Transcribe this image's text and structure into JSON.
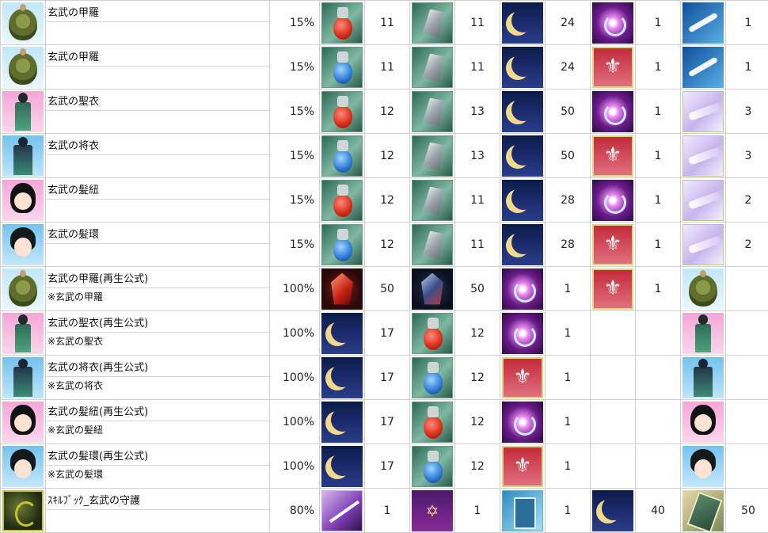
{
  "rows": [
    {
      "name": "玄武の甲羅",
      "sub": "",
      "item_icon": "turtle-shell-icon",
      "rate": "15%",
      "materials": [
        {
          "icon": "red-bag-icon",
          "qty": "11"
        },
        {
          "icon": "metal-shard-icon",
          "qty": "11"
        },
        {
          "icon": "crescent-moon-icon",
          "qty": "24"
        },
        {
          "icon": "magic-orb-icon",
          "qty": "1"
        },
        {
          "icon": "feather-icon",
          "qty": "1"
        }
      ],
      "result_icon": ""
    },
    {
      "name": "玄武の甲羅",
      "sub": "",
      "item_icon": "turtle-shell-icon",
      "rate": "15%",
      "materials": [
        {
          "icon": "blue-bag-icon",
          "qty": "11"
        },
        {
          "icon": "metal-shard-icon",
          "qty": "11"
        },
        {
          "icon": "crescent-moon-icon",
          "qty": "24"
        },
        {
          "icon": "fleur-de-lis-icon",
          "qty": "1"
        },
        {
          "icon": "feather-icon",
          "qty": "1"
        }
      ],
      "result_icon": ""
    },
    {
      "name": "玄武の聖衣",
      "sub": "",
      "item_icon": "sacred-robe-icon",
      "rate": "15%",
      "materials": [
        {
          "icon": "red-bag-icon",
          "qty": "12"
        },
        {
          "icon": "metal-shard-icon",
          "qty": "13"
        },
        {
          "icon": "crescent-moon-icon",
          "qty": "50"
        },
        {
          "icon": "magic-orb-icon",
          "qty": "1"
        },
        {
          "icon": "angel-wing-icon",
          "qty": "3"
        }
      ],
      "result_icon": ""
    },
    {
      "name": "玄武の将衣",
      "sub": "",
      "item_icon": "general-coat-icon",
      "rate": "15%",
      "materials": [
        {
          "icon": "blue-bag-icon",
          "qty": "12"
        },
        {
          "icon": "metal-shard-icon",
          "qty": "13"
        },
        {
          "icon": "crescent-moon-icon",
          "qty": "50"
        },
        {
          "icon": "fleur-de-lis-icon",
          "qty": "1"
        },
        {
          "icon": "angel-wing-icon",
          "qty": "3"
        }
      ],
      "result_icon": ""
    },
    {
      "name": "玄武の髪紐",
      "sub": "",
      "item_icon": "hair-string-icon",
      "rate": "15%",
      "materials": [
        {
          "icon": "red-bag-icon",
          "qty": "12"
        },
        {
          "icon": "metal-shard-icon",
          "qty": "11"
        },
        {
          "icon": "crescent-moon-icon",
          "qty": "28"
        },
        {
          "icon": "magic-orb-icon",
          "qty": "1"
        },
        {
          "icon": "angel-wing-icon",
          "qty": "2"
        }
      ],
      "result_icon": ""
    },
    {
      "name": "玄武の髪環",
      "sub": "",
      "item_icon": "hair-ring-icon",
      "rate": "15%",
      "materials": [
        {
          "icon": "blue-bag-icon",
          "qty": "12"
        },
        {
          "icon": "metal-shard-icon",
          "qty": "11"
        },
        {
          "icon": "crescent-moon-icon",
          "qty": "28"
        },
        {
          "icon": "fleur-de-lis-icon",
          "qty": "1"
        },
        {
          "icon": "angel-wing-icon",
          "qty": "2"
        }
      ],
      "result_icon": ""
    },
    {
      "name": "玄武の甲羅(再生公式)",
      "sub": "※玄武の甲羅",
      "item_icon": "turtle-shell-icon",
      "rate": "100%",
      "materials": [
        {
          "icon": "red-gem-icon",
          "qty": "50"
        },
        {
          "icon": "blue-gem-icon",
          "qty": "50"
        },
        {
          "icon": "magic-orb-icon",
          "qty": "1"
        },
        {
          "icon": "fleur-de-lis-icon",
          "qty": "1"
        },
        {
          "icon": "",
          "qty": ""
        }
      ],
      "result_icon": "turtle-shell-icon"
    },
    {
      "name": "玄武の聖衣(再生公式)",
      "sub": "※玄武の聖衣",
      "item_icon": "sacred-robe-icon",
      "rate": "100%",
      "materials": [
        {
          "icon": "crescent-moon-icon",
          "qty": "17"
        },
        {
          "icon": "red-bag-icon",
          "qty": "12"
        },
        {
          "icon": "magic-orb-icon",
          "qty": "1"
        },
        {
          "icon": "",
          "qty": ""
        },
        {
          "icon": "",
          "qty": ""
        }
      ],
      "result_icon": "sacred-robe-icon"
    },
    {
      "name": "玄武の将衣(再生公式)",
      "sub": "※玄武の将衣",
      "item_icon": "general-coat-icon",
      "rate": "100%",
      "materials": [
        {
          "icon": "crescent-moon-icon",
          "qty": "17"
        },
        {
          "icon": "blue-bag-icon",
          "qty": "12"
        },
        {
          "icon": "fleur-de-lis-icon",
          "qty": "1"
        },
        {
          "icon": "",
          "qty": ""
        },
        {
          "icon": "",
          "qty": ""
        }
      ],
      "result_icon": "general-coat-icon"
    },
    {
      "name": "玄武の髪紐(再生公式)",
      "sub": "※玄武の髪紐",
      "item_icon": "hair-string-icon",
      "rate": "100%",
      "materials": [
        {
          "icon": "crescent-moon-icon",
          "qty": "17"
        },
        {
          "icon": "red-bag-icon",
          "qty": "12"
        },
        {
          "icon": "magic-orb-icon",
          "qty": "1"
        },
        {
          "icon": "",
          "qty": ""
        },
        {
          "icon": "",
          "qty": ""
        }
      ],
      "result_icon": "hair-string-icon"
    },
    {
      "name": "玄武の髪環(再生公式)",
      "sub": "※玄武の髪環",
      "item_icon": "hair-ring-icon",
      "rate": "100%",
      "materials": [
        {
          "icon": "crescent-moon-icon",
          "qty": "17"
        },
        {
          "icon": "blue-bag-icon",
          "qty": "12"
        },
        {
          "icon": "fleur-de-lis-icon",
          "qty": "1"
        },
        {
          "icon": "",
          "qty": ""
        },
        {
          "icon": "",
          "qty": ""
        }
      ],
      "result_icon": "hair-ring-icon"
    },
    {
      "name": "ｽｷﾙﾌﾞｯｸ_玄武の守護",
      "sub": "",
      "item_icon": "skill-book-icon",
      "rate": "80%",
      "materials": [
        {
          "icon": "magic-wand-icon",
          "qty": "1"
        },
        {
          "icon": "potion-bottle-icon",
          "qty": "1"
        },
        {
          "icon": "blue-tome-icon",
          "qty": "1"
        },
        {
          "icon": "crescent-moon-icon",
          "qty": "40"
        },
        {
          "icon": "card-icon",
          "qty": "50"
        }
      ],
      "result_icon": ""
    }
  ]
}
